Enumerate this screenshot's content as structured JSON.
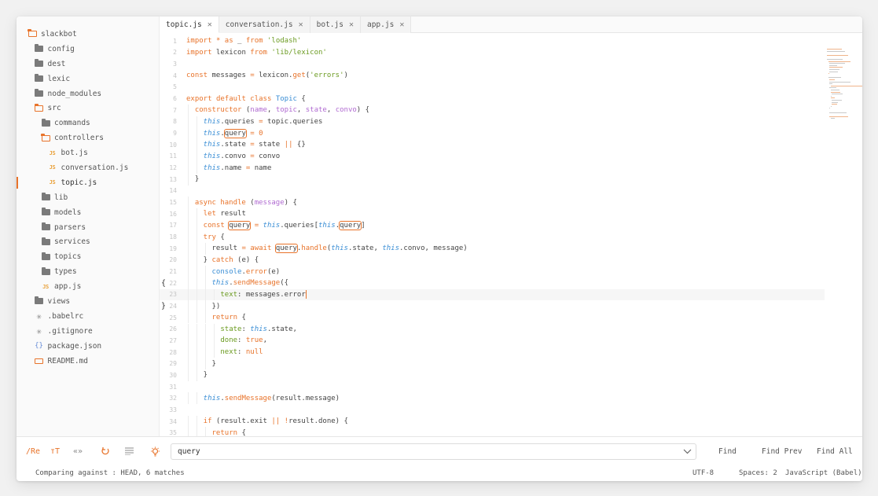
{
  "sidebar": {
    "items": [
      {
        "label": "slackbot",
        "type": "folder-open",
        "depth": 0
      },
      {
        "label": "config",
        "type": "folder",
        "depth": 1
      },
      {
        "label": "dest",
        "type": "folder",
        "depth": 1
      },
      {
        "label": "lexic",
        "type": "folder",
        "depth": 1
      },
      {
        "label": "node_modules",
        "type": "folder",
        "depth": 1
      },
      {
        "label": "src",
        "type": "folder-open",
        "depth": 1
      },
      {
        "label": "commands",
        "type": "folder",
        "depth": 2
      },
      {
        "label": "controllers",
        "type": "folder-open",
        "depth": 2
      },
      {
        "label": "bot.js",
        "type": "js",
        "depth": 3
      },
      {
        "label": "conversation.js",
        "type": "js",
        "depth": 3
      },
      {
        "label": "topic.js",
        "type": "js",
        "depth": 3,
        "selected": true
      },
      {
        "label": "lib",
        "type": "folder",
        "depth": 2
      },
      {
        "label": "models",
        "type": "folder",
        "depth": 2
      },
      {
        "label": "parsers",
        "type": "folder",
        "depth": 2
      },
      {
        "label": "services",
        "type": "folder",
        "depth": 2
      },
      {
        "label": "topics",
        "type": "folder",
        "depth": 2
      },
      {
        "label": "types",
        "type": "folder",
        "depth": 2
      },
      {
        "label": "app.js",
        "type": "js",
        "depth": 2
      },
      {
        "label": "views",
        "type": "folder",
        "depth": 1
      },
      {
        "label": ".babelrc",
        "type": "star",
        "depth": 1
      },
      {
        "label": ".gitignore",
        "type": "star",
        "depth": 1
      },
      {
        "label": "package.json",
        "type": "json",
        "depth": 1
      },
      {
        "label": "README.md",
        "type": "md",
        "depth": 1
      }
    ]
  },
  "tabs": [
    {
      "label": "topic.js",
      "active": true
    },
    {
      "label": "conversation.js"
    },
    {
      "label": "bot.js"
    },
    {
      "label": "app.js"
    }
  ],
  "editor": {
    "current_line": 23,
    "lines": [
      {
        "n": "1",
        "indent": 0,
        "tokens": [
          [
            "kw",
            "import"
          ],
          [
            "p",
            " "
          ],
          [
            "kw",
            "*"
          ],
          [
            "p",
            " "
          ],
          [
            "kw",
            "as"
          ],
          [
            "p",
            " _ "
          ],
          [
            "kw",
            "from"
          ],
          [
            "p",
            " "
          ],
          [
            "str",
            "'lodash'"
          ]
        ]
      },
      {
        "n": "2",
        "indent": 0,
        "tokens": [
          [
            "kw",
            "import"
          ],
          [
            "p",
            " lexicon "
          ],
          [
            "kw",
            "from"
          ],
          [
            "p",
            " "
          ],
          [
            "str",
            "'lib/lexicon'"
          ]
        ]
      },
      {
        "n": "3",
        "indent": 0,
        "tokens": []
      },
      {
        "n": "4",
        "indent": 0,
        "tokens": [
          [
            "kw",
            "const"
          ],
          [
            "p",
            " messages "
          ],
          [
            "kw",
            "="
          ],
          [
            "p",
            " lexicon."
          ],
          [
            "fn",
            "get"
          ],
          [
            "p",
            "("
          ],
          [
            "str",
            "'errors'"
          ],
          [
            "p",
            ")"
          ]
        ]
      },
      {
        "n": "5",
        "indent": 0,
        "tokens": []
      },
      {
        "n": "6",
        "indent": 0,
        "tokens": [
          [
            "kw",
            "export"
          ],
          [
            "p",
            " "
          ],
          [
            "kw",
            "default"
          ],
          [
            "p",
            " "
          ],
          [
            "kw",
            "class"
          ],
          [
            "p",
            " "
          ],
          [
            "cls",
            "Topic"
          ],
          [
            "p",
            " {"
          ]
        ]
      },
      {
        "n": "7",
        "indent": 1,
        "tokens": [
          [
            "fn",
            "constructor"
          ],
          [
            "p",
            " ("
          ],
          [
            "prm",
            "name"
          ],
          [
            "p",
            ", "
          ],
          [
            "prm",
            "topic"
          ],
          [
            "p",
            ", "
          ],
          [
            "prm",
            "state"
          ],
          [
            "p",
            ", "
          ],
          [
            "prm",
            "convo"
          ],
          [
            "p",
            ") {"
          ]
        ]
      },
      {
        "n": "8",
        "indent": 2,
        "tokens": [
          [
            "th",
            "this"
          ],
          [
            "p",
            ".queries "
          ],
          [
            "kw",
            "="
          ],
          [
            "p",
            " topic.queries"
          ]
        ]
      },
      {
        "n": "9",
        "indent": 2,
        "tokens": [
          [
            "th",
            "this"
          ],
          [
            "p",
            "."
          ],
          [
            "hl",
            "query"
          ],
          [
            "p",
            " "
          ],
          [
            "kw",
            "="
          ],
          [
            "p",
            " "
          ],
          [
            "kw",
            "0"
          ]
        ]
      },
      {
        "n": "10",
        "indent": 2,
        "tokens": [
          [
            "th",
            "this"
          ],
          [
            "p",
            ".state "
          ],
          [
            "kw",
            "="
          ],
          [
            "p",
            " state "
          ],
          [
            "kw",
            "||"
          ],
          [
            "p",
            " {}"
          ]
        ]
      },
      {
        "n": "11",
        "indent": 2,
        "tokens": [
          [
            "th",
            "this"
          ],
          [
            "p",
            ".convo "
          ],
          [
            "kw",
            "="
          ],
          [
            "p",
            " convo"
          ]
        ]
      },
      {
        "n": "12",
        "indent": 2,
        "tokens": [
          [
            "th",
            "this"
          ],
          [
            "p",
            ".name "
          ],
          [
            "kw",
            "="
          ],
          [
            "p",
            " name"
          ]
        ]
      },
      {
        "n": "13",
        "indent": 1,
        "tokens": [
          [
            "p",
            "}"
          ]
        ]
      },
      {
        "n": "14",
        "indent": 0,
        "tokens": []
      },
      {
        "n": "15",
        "indent": 1,
        "tokens": [
          [
            "kw",
            "async"
          ],
          [
            "p",
            " "
          ],
          [
            "fn",
            "handle"
          ],
          [
            "p",
            " ("
          ],
          [
            "prm",
            "message"
          ],
          [
            "p",
            ") {"
          ]
        ]
      },
      {
        "n": "16",
        "indent": 2,
        "tokens": [
          [
            "kw",
            "let"
          ],
          [
            "p",
            " result"
          ]
        ]
      },
      {
        "n": "17",
        "indent": 2,
        "tokens": [
          [
            "kw",
            "const"
          ],
          [
            "p",
            " "
          ],
          [
            "hl",
            "query"
          ],
          [
            "p",
            " "
          ],
          [
            "kw",
            "="
          ],
          [
            "p",
            " "
          ],
          [
            "th",
            "this"
          ],
          [
            "p",
            ".queries["
          ],
          [
            "th",
            "this"
          ],
          [
            "p",
            "."
          ],
          [
            "hl",
            "query"
          ],
          [
            "p",
            "]"
          ]
        ]
      },
      {
        "n": "18",
        "indent": 2,
        "tokens": [
          [
            "kw",
            "try"
          ],
          [
            "p",
            " {"
          ]
        ]
      },
      {
        "n": "19",
        "indent": 3,
        "tokens": [
          [
            "p",
            "result "
          ],
          [
            "kw",
            "="
          ],
          [
            "p",
            " "
          ],
          [
            "kw",
            "await"
          ],
          [
            "p",
            " "
          ],
          [
            "hl",
            "query"
          ],
          [
            "p",
            "."
          ],
          [
            "fn",
            "handle"
          ],
          [
            "p",
            "("
          ],
          [
            "th",
            "this"
          ],
          [
            "p",
            ".state, "
          ],
          [
            "th",
            "this"
          ],
          [
            "p",
            ".convo, message)"
          ]
        ]
      },
      {
        "n": "20",
        "indent": 2,
        "tokens": [
          [
            "p",
            "} "
          ],
          [
            "kw",
            "catch"
          ],
          [
            "p",
            " (e) {"
          ]
        ]
      },
      {
        "n": "21",
        "indent": 3,
        "tokens": [
          [
            "ob",
            "console"
          ],
          [
            "p",
            "."
          ],
          [
            "fn",
            "error"
          ],
          [
            "p",
            "(e)"
          ]
        ]
      },
      {
        "n": "22",
        "indent": 3,
        "mark": "{",
        "tokens": [
          [
            "th",
            "this"
          ],
          [
            "p",
            "."
          ],
          [
            "fn",
            "sendMessage"
          ],
          [
            "p",
            "({"
          ]
        ]
      },
      {
        "n": "23",
        "indent": 4,
        "tokens": [
          [
            "prop",
            "text"
          ],
          [
            "p",
            ": messages.error"
          ],
          [
            "cursor",
            ""
          ]
        ]
      },
      {
        "n": "24",
        "indent": 3,
        "mark": "}",
        "tokens": [
          [
            "p",
            "})"
          ]
        ]
      },
      {
        "n": "25",
        "indent": 3,
        "tokens": [
          [
            "kw",
            "return"
          ],
          [
            "p",
            " {"
          ]
        ]
      },
      {
        "n": "26",
        "indent": 4,
        "tokens": [
          [
            "prop",
            "state"
          ],
          [
            "p",
            ": "
          ],
          [
            "th",
            "this"
          ],
          [
            "p",
            ".state,"
          ]
        ]
      },
      {
        "n": "27",
        "indent": 4,
        "tokens": [
          [
            "prop",
            "done"
          ],
          [
            "p",
            ": "
          ],
          [
            "kw",
            "true"
          ],
          [
            "p",
            ","
          ]
        ]
      },
      {
        "n": "28",
        "indent": 4,
        "tokens": [
          [
            "prop",
            "next"
          ],
          [
            "p",
            ": "
          ],
          [
            "kw",
            "null"
          ]
        ]
      },
      {
        "n": "29",
        "indent": 3,
        "tokens": [
          [
            "p",
            "}"
          ]
        ]
      },
      {
        "n": "30",
        "indent": 2,
        "tokens": [
          [
            "p",
            "}"
          ]
        ]
      },
      {
        "n": "31",
        "indent": 0,
        "tokens": []
      },
      {
        "n": "32",
        "indent": 2,
        "tokens": [
          [
            "th",
            "this"
          ],
          [
            "p",
            "."
          ],
          [
            "fn",
            "sendMessage"
          ],
          [
            "p",
            "(result.message)"
          ]
        ]
      },
      {
        "n": "33",
        "indent": 0,
        "tokens": []
      },
      {
        "n": "34",
        "indent": 2,
        "tokens": [
          [
            "kw",
            "if"
          ],
          [
            "p",
            " (result.exit "
          ],
          [
            "kw",
            "||"
          ],
          [
            "p",
            " "
          ],
          [
            "kw",
            "!"
          ],
          [
            "p",
            "result.done) {"
          ]
        ]
      },
      {
        "n": "35",
        "indent": 3,
        "tokens": [
          [
            "kw",
            "return"
          ],
          [
            "p",
            " {"
          ]
        ]
      }
    ]
  },
  "findbar": {
    "regex_label": "/Re",
    "case_label": "тT",
    "whole_word_label": "«»",
    "wrap_icon": "wrap-icon",
    "in_selection_icon": "lines-icon",
    "highlight_icon": "lightbulb-icon",
    "query": "query",
    "find_label": "Find",
    "find_prev_label": "Find Prev",
    "find_all_label": "Find All"
  },
  "statusbar": {
    "message": "Comparing against : HEAD, 6 matches",
    "encoding": "UTF-8",
    "indent": "Spaces: 2",
    "syntax": "JavaScript (Babel)"
  },
  "colors": {
    "accent": "#e8732a",
    "keyword": "#e8732a",
    "string": "#6a9a1f",
    "this": "#3a8ed5",
    "param": "#b06bd1"
  }
}
